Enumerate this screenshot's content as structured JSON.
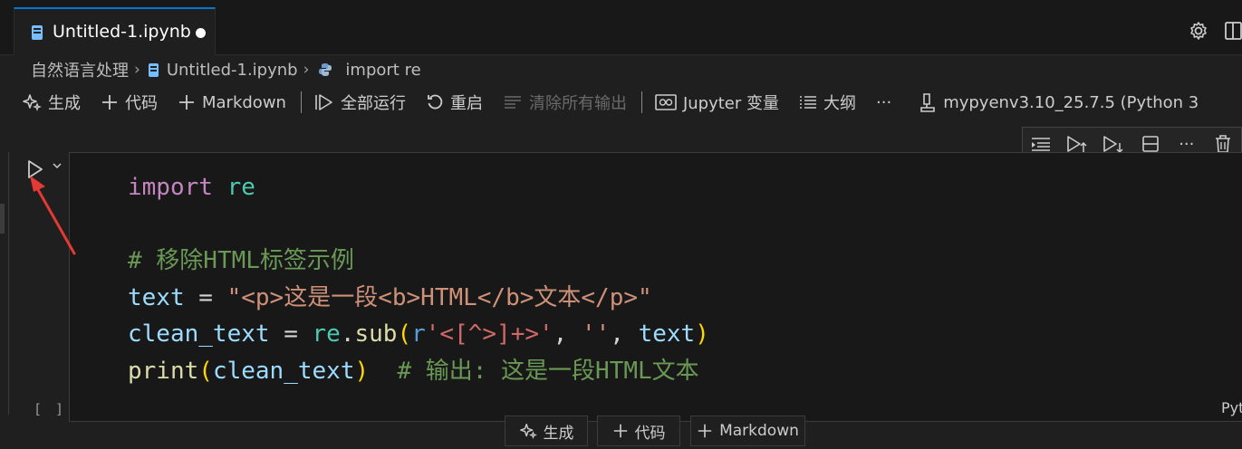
{
  "tab": {
    "title": "Untitled-1.ipynb",
    "modified": true
  },
  "breadcrumb": {
    "folder": "自然语言处理",
    "file": "Untitled-1.ipynb",
    "symbol": "import re"
  },
  "toolbar": {
    "generate": "生成",
    "code": "代码",
    "markdown": "Markdown",
    "run_all": "全部运行",
    "restart": "重启",
    "clear_outputs": "清除所有输出",
    "variables": "Jupyter 变量",
    "outline": "大纲",
    "more": "···",
    "kernel": "mypyenv3.10_25.7.5 (Python 3"
  },
  "cell": {
    "execution_count": "[ ]",
    "language": "Pyt",
    "code": {
      "l1_import": "import",
      "l1_module": "re",
      "l3_comment": "# 移除HTML标签示例",
      "l4_var": "text",
      "l4_op": " = ",
      "l4_str": "\"<p>这是一段<b>HTML</b>文本</p>\"",
      "l5_var": "clean_text",
      "l5_op": " = ",
      "l5_mod": "re",
      "l5_dot": ".",
      "l5_fn": "sub",
      "l5_paren_open": "(",
      "l5_rprefix": "r",
      "l5_q1": "'",
      "l5_regex": "<[^>]+>",
      "l5_q2": "'",
      "l5_comma1": ", ",
      "l5_empty": "''",
      "l5_comma2": ", ",
      "l5_arg": "text",
      "l5_paren_close": ")",
      "l6_fn": "print",
      "l6_paren_open": "(",
      "l6_arg": "clean_text",
      "l6_paren_close": ")",
      "l6_comment": "  # 输出: 这是一段HTML文本"
    }
  },
  "insert_bar": {
    "generate": "生成",
    "code": "代码",
    "markdown": "Markdown"
  },
  "icons": [
    "notebook-icon",
    "gear-icon",
    "split-editor-icon",
    "python-icon",
    "sparkle-icon",
    "plus-icon",
    "run-all-icon",
    "restart-icon",
    "clear-icon",
    "variables-icon",
    "outline-icon",
    "kernel-icon",
    "run-cell-icon",
    "chevron-down-icon",
    "run-next-icon",
    "run-above-icon",
    "run-below-icon",
    "split-cell-icon",
    "more-icon",
    "trash-icon",
    "annotation-arrow"
  ],
  "colors": {
    "accent": "#0078d4",
    "keyword": "#c586c0",
    "string": "#ce9178",
    "comment": "#6a9955",
    "variable": "#9cdcfe",
    "annotation": "#e53935"
  }
}
